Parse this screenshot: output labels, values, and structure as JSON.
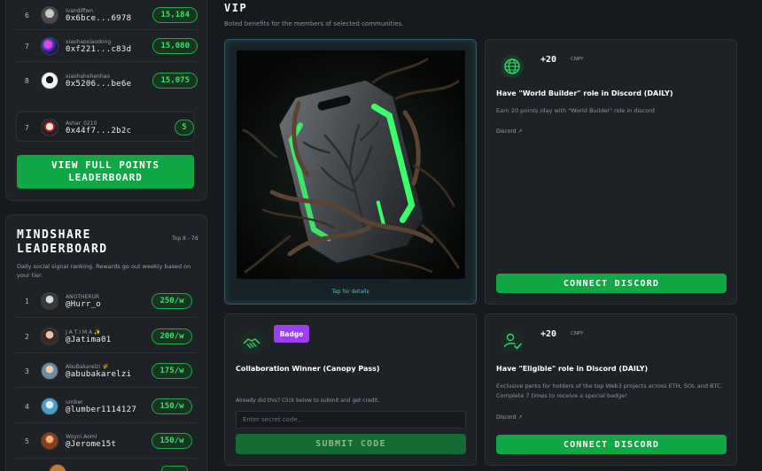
{
  "points_leaderboard": {
    "rows": [
      {
        "rank": "6",
        "label": "ivandiffwn",
        "handle": "0x6bce...6978",
        "points": "15,184"
      },
      {
        "rank": "7",
        "label": "xiaohaoxiaodong",
        "handle": "0xf221...c83d",
        "points": "15,080"
      },
      {
        "rank": "8",
        "label": "xiaohahehenhao",
        "handle": "0x5206...be6e",
        "points": "15,075"
      }
    ],
    "you_row": {
      "rank": "7",
      "label": "Ashar_0210",
      "handle": "0x44f7...2b2c",
      "points": "5"
    },
    "view_full_label": "VIEW FULL POINTS LEADERBOARD"
  },
  "mindshare": {
    "title": "MINDSHARE LEADERBOARD",
    "period": "Top 8 - 7d",
    "description": "Daily social signal ranking. Rewards go out weekly based on your tier.",
    "rows": [
      {
        "rank": "1",
        "label": "ANOTHERUR",
        "handle": "@Hurr_o",
        "score": "250/w"
      },
      {
        "rank": "2",
        "label": "J A T I M A ✨",
        "handle": "@Jatima01",
        "score": "200/w"
      },
      {
        "rank": "3",
        "label": "AbuBakarelzi 🌾",
        "handle": "@abubakarelzi",
        "score": "175/w"
      },
      {
        "rank": "4",
        "label": "umber",
        "handle": "@lumber1114127",
        "score": "150/w"
      },
      {
        "rank": "5",
        "label": "Woyni Aoml",
        "handle": "@Jerome15t",
        "score": "150/w"
      }
    ]
  },
  "vip": {
    "title": "VIP",
    "subtitle": "Boted benefits for the members of selected communities.",
    "nft_card": {
      "caption": "Tap for details"
    },
    "quest_world_builder": {
      "points": "+20",
      "currency": "CNPY",
      "title": "Have \"World Builder\" role in Discord (DAILY)",
      "description": "Earn 20 points /day with \"World Builder\" role in discord",
      "link": "Discord ↗",
      "button": "CONNECT DISCORD"
    },
    "quest_collab": {
      "badge": "Badge",
      "title": "Collaboration Winner (Canopy Pass)",
      "hint": "Already did this? Click below to submit and get credit.",
      "input_placeholder": "Enter secret code...",
      "button": "SUBMIT CODE"
    },
    "quest_eligible": {
      "points": "+20",
      "currency": "CNPY",
      "title": "Have \"Eligible\" role in Discord (DAILY)",
      "description": "Exclusive perks for holders of the top Web3 projects across ETH, SOL and BTC. Complete 7 times to receive a special badge!",
      "link": "Discord ↗",
      "button": "CONNECT DISCORD"
    }
  },
  "colors": {
    "accent_green": "#10a844",
    "pill_green": "#3ee06b",
    "badge_purple": "#9b3ff0",
    "nft_glow": "#39ff6a"
  }
}
